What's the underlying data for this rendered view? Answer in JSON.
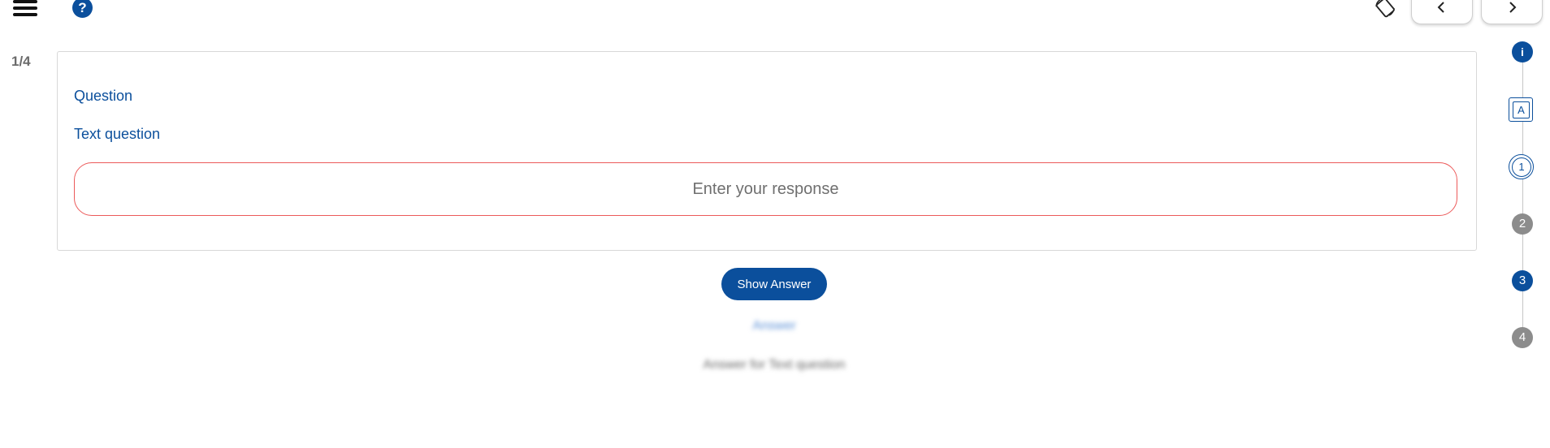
{
  "counter": "1/4",
  "question": {
    "title": "Question",
    "subtitle": "Text question",
    "response_placeholder": "Enter your response"
  },
  "show_answer_label": "Show Answer",
  "answer": {
    "label": "Answer",
    "text": "Answer for Text question"
  },
  "stepper": {
    "info": "i",
    "a": "A",
    "s1": "1",
    "s2": "2",
    "s3": "3",
    "s4": "4"
  },
  "help": "?",
  "colors": {
    "primary": "#0b4f9c",
    "inactive_step": "#8c8c8c",
    "input_border_error": "#ec5a5a"
  },
  "icons": [
    "menu-icon",
    "help-icon",
    "screen-rotation-icon",
    "chevron-left-icon",
    "chevron-right-icon"
  ]
}
